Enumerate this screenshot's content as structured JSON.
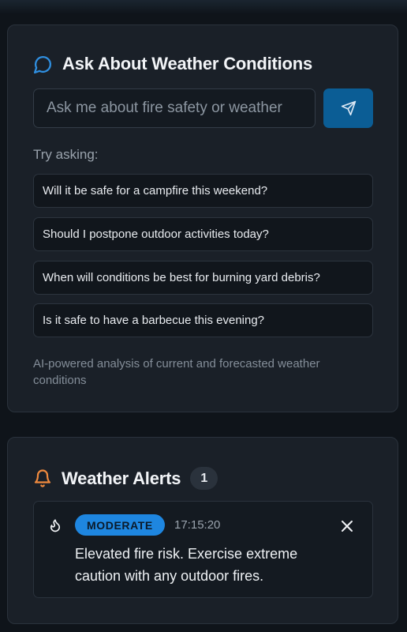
{
  "ask": {
    "title": "Ask About Weather Conditions",
    "input_placeholder": "Ask me about fire safety or weather",
    "send_icon": "send-icon",
    "try_label": "Try asking:",
    "suggestions": [
      "Will it be safe for a campfire this weekend?",
      "Should I postpone outdoor activities today?",
      "When will conditions be best for burning yard debris?",
      "Is it safe to have a barbecue this evening?"
    ],
    "footnote": "AI-powered analysis of current and forecasted weather conditions"
  },
  "alerts": {
    "title": "Weather Alerts",
    "count": "1",
    "items": [
      {
        "icon": "flame-icon",
        "severity": "MODERATE",
        "time": "17:15:20",
        "message": "Elevated fire risk. Exercise extreme caution with any outdoor fires."
      }
    ]
  },
  "colors": {
    "accent": "#0b5d95",
    "chat_icon": "#2f8fe0",
    "bell_icon": "#f08a3e",
    "severity_badge": "#1e86e0"
  }
}
